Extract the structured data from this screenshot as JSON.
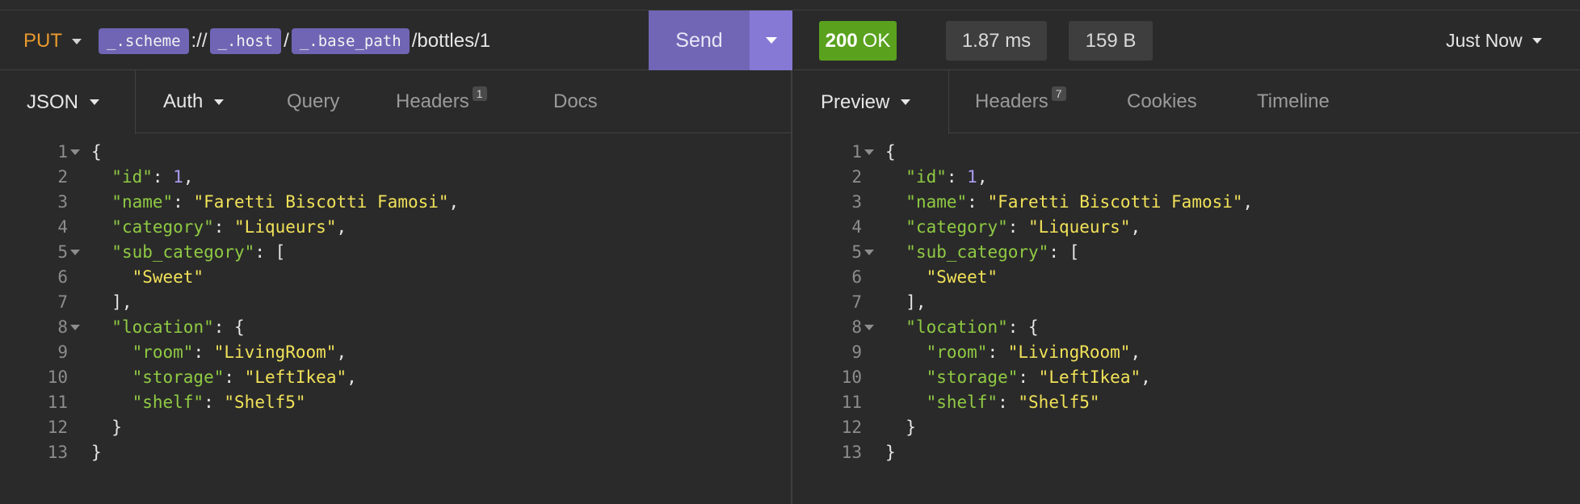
{
  "request": {
    "method": "PUT",
    "url_tags": [
      "_.scheme",
      "_.host",
      "_.base_path"
    ],
    "url_separators": [
      "://",
      "/"
    ],
    "url_path": "/bottles/1",
    "send_label": "Send",
    "tabs": [
      {
        "label": "JSON",
        "dropdown": true
      },
      {
        "label": "Auth",
        "dropdown": true
      },
      {
        "label": "Query"
      },
      {
        "label": "Headers",
        "badge": "1"
      },
      {
        "label": "Docs"
      }
    ]
  },
  "response": {
    "status_code": "200",
    "status_text": "OK",
    "time": "1.87 ms",
    "size": "159 B",
    "timestamp": "Just Now",
    "tabs": [
      {
        "label": "Preview",
        "dropdown": true
      },
      {
        "label": "Headers",
        "badge": "7"
      },
      {
        "label": "Cookies"
      },
      {
        "label": "Timeline"
      }
    ]
  },
  "colors": {
    "method": "#e99a2e",
    "tag": "#6f65b4",
    "send": "#7166b5",
    "send_dropdown": "#8679d6",
    "status_ok": "#5aa21e",
    "json_key": "#8fca43",
    "json_string": "#f1e259",
    "json_number": "#a99bf2"
  },
  "icons": {
    "dropdown": "chevron-down-icon",
    "fold": "fold-triangle-icon"
  },
  "body_lines": [
    {
      "n": "1",
      "fold": true,
      "tokens": [
        [
          "p",
          "{"
        ]
      ]
    },
    {
      "n": "2",
      "tokens": [
        [
          "p",
          "  "
        ],
        [
          "k",
          "\"id\""
        ],
        [
          "p",
          ": "
        ],
        [
          "n",
          "1"
        ],
        [
          "p",
          ","
        ]
      ]
    },
    {
      "n": "3",
      "tokens": [
        [
          "p",
          "  "
        ],
        [
          "k",
          "\"name\""
        ],
        [
          "p",
          ": "
        ],
        [
          "s",
          "\"Faretti Biscotti Famosi\""
        ],
        [
          "p",
          ","
        ]
      ]
    },
    {
      "n": "4",
      "tokens": [
        [
          "p",
          "  "
        ],
        [
          "k",
          "\"category\""
        ],
        [
          "p",
          ": "
        ],
        [
          "s",
          "\"Liqueurs\""
        ],
        [
          "p",
          ","
        ]
      ]
    },
    {
      "n": "5",
      "fold": true,
      "tokens": [
        [
          "p",
          "  "
        ],
        [
          "k",
          "\"sub_category\""
        ],
        [
          "p",
          ": ["
        ]
      ]
    },
    {
      "n": "6",
      "tokens": [
        [
          "p",
          "    "
        ],
        [
          "s",
          "\"Sweet\""
        ]
      ]
    },
    {
      "n": "7",
      "tokens": [
        [
          "p",
          "  ],"
        ]
      ]
    },
    {
      "n": "8",
      "fold": true,
      "tokens": [
        [
          "p",
          "  "
        ],
        [
          "k",
          "\"location\""
        ],
        [
          "p",
          ": {"
        ]
      ]
    },
    {
      "n": "9",
      "tokens": [
        [
          "p",
          "    "
        ],
        [
          "k",
          "\"room\""
        ],
        [
          "p",
          ": "
        ],
        [
          "s",
          "\"LivingRoom\""
        ],
        [
          "p",
          ","
        ]
      ]
    },
    {
      "n": "10",
      "tokens": [
        [
          "p",
          "    "
        ],
        [
          "k",
          "\"storage\""
        ],
        [
          "p",
          ": "
        ],
        [
          "s",
          "\"LeftIkea\""
        ],
        [
          "p",
          ","
        ]
      ]
    },
    {
      "n": "11",
      "tokens": [
        [
          "p",
          "    "
        ],
        [
          "k",
          "\"shelf\""
        ],
        [
          "p",
          ": "
        ],
        [
          "s",
          "\"Shelf5\""
        ]
      ]
    },
    {
      "n": "12",
      "tokens": [
        [
          "p",
          "  }"
        ]
      ]
    },
    {
      "n": "13",
      "tokens": [
        [
          "p",
          "}"
        ]
      ]
    }
  ]
}
